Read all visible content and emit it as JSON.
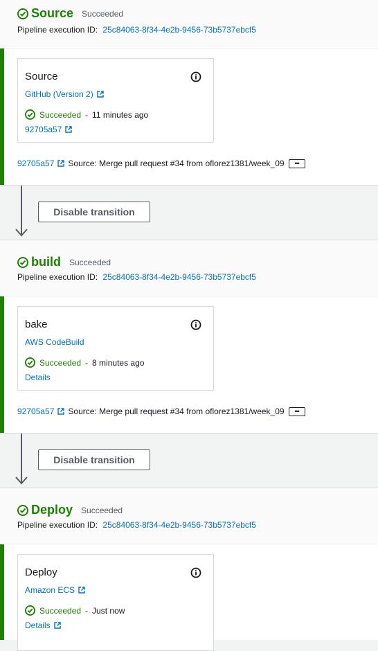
{
  "stages": [
    {
      "name": "Source",
      "status": "Succeeded",
      "exec_label": "Pipeline execution ID:",
      "exec_id": "25c84063-8f34-4e2b-9456-73b5737ebcf5",
      "action": {
        "name": "Source",
        "provider": "GitHub (Version 2)",
        "provider_external": true,
        "status": "Succeeded",
        "time": "11 minutes ago",
        "detail": "92705a57",
        "detail_external": true
      },
      "commit": {
        "hash": "92705a57",
        "message": "Source: Merge pull request #34 from oflorez1381/week_09"
      }
    },
    {
      "name": "build",
      "status": "Succeeded",
      "exec_label": "Pipeline execution ID:",
      "exec_id": "25c84063-8f34-4e2b-9456-73b5737ebcf5",
      "action": {
        "name": "bake",
        "provider": "AWS CodeBuild",
        "provider_external": false,
        "status": "Succeeded",
        "time": "8 minutes ago",
        "detail": "Details",
        "detail_external": false
      },
      "commit": {
        "hash": "92705a57",
        "message": "Source: Merge pull request #34 from oflorez1381/week_09"
      }
    },
    {
      "name": "Deploy",
      "status": "Succeeded",
      "exec_label": "Pipeline execution ID:",
      "exec_id": "25c84063-8f34-4e2b-9456-73b5737ebcf5",
      "action": {
        "name": "Deploy",
        "provider": "Amazon ECS",
        "provider_external": true,
        "status": "Succeeded",
        "time": "Just now",
        "detail": "Details",
        "detail_external": true
      }
    }
  ],
  "transitions": [
    {
      "button_label": "Disable transition"
    },
    {
      "button_label": "Disable transition"
    }
  ],
  "colors": {
    "success": "#1d8102",
    "link": "#0073bb",
    "stage_bar": "#1d8102"
  },
  "icons": {
    "status": "check-circle-icon",
    "info": "info-icon",
    "external": "external-link-icon",
    "more": "ellipsis-icon",
    "arrow": "arrow-down-icon"
  }
}
